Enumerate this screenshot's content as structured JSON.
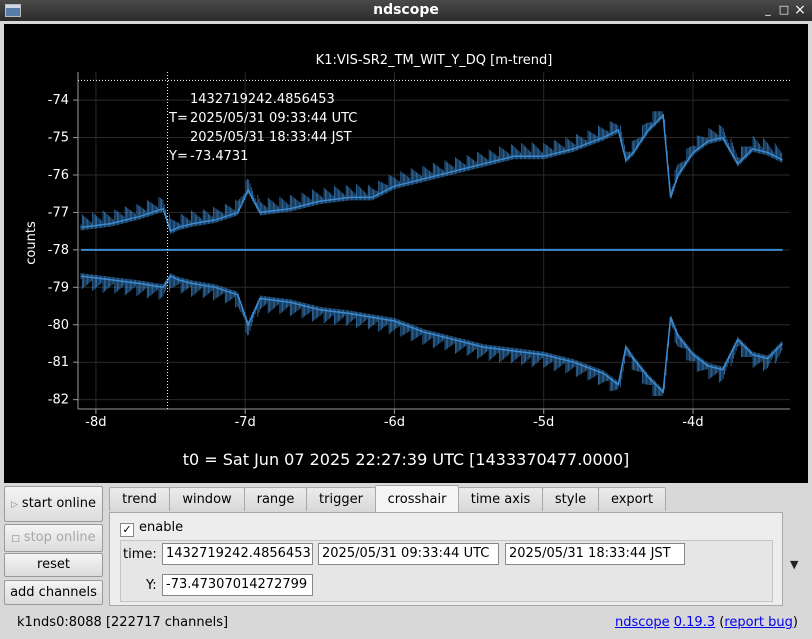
{
  "window": {
    "title": "ndscope",
    "minimize": "_",
    "maximize": "□",
    "close": "×"
  },
  "plot": {
    "title": "K1:VIS-SR2_TM_WIT_Y_DQ [m-trend]",
    "ylabel": "counts",
    "t0_label": "t0 = Sat Jun 07 2025 22:27:39 UTC [1433370477.0000]",
    "crosshair": {
      "gps": "1432719242.4856453",
      "t_prefix": "T=",
      "utc": "2025/05/31 09:33:44 UTC",
      "jst": "2025/05/31 18:33:44 JST",
      "y_prefix": "Y=",
      "y": "-73.4731"
    },
    "trace_color": "#3c8ad0"
  },
  "chart_data": {
    "type": "line",
    "title": "K1:VIS-SR2_TM_WIT_Y_DQ [m-trend]",
    "ylabel": "counts",
    "xlabel": "",
    "x_unit": "days",
    "xlim": [
      -8.12,
      -3.35
    ],
    "ylim": [
      -82.25,
      -73.25
    ],
    "x_ticks": [
      -8,
      -7,
      -6,
      -5,
      -4
    ],
    "x_tick_labels": [
      "-8d",
      "-7d",
      "-6d",
      "-5d",
      "-4d"
    ],
    "y_ticks": [
      -74,
      -75,
      -76,
      -77,
      -78,
      -79,
      -80,
      -81,
      -82
    ],
    "y_tick_labels": [
      "-74",
      "-75",
      "-76",
      "-77",
      "-78",
      "-79",
      "-80",
      "-81",
      "-82"
    ],
    "grid": true,
    "crosshair": {
      "x": -7.52,
      "y": -73.4731
    },
    "series": [
      {
        "role": "max",
        "x": [
          -8.1,
          -7.9,
          -7.7,
          -7.55,
          -7.5,
          -7.45,
          -7.35,
          -7.2,
          -7.05,
          -6.98,
          -6.9,
          -6.7,
          -6.5,
          -6.3,
          -6.15,
          -6.0,
          -5.8,
          -5.6,
          -5.4,
          -5.2,
          -5.0,
          -4.8,
          -4.6,
          -4.5,
          -4.45,
          -4.4,
          -4.3,
          -4.2,
          -4.15,
          -4.1,
          -4.0,
          -3.9,
          -3.8,
          -3.7,
          -3.6,
          -3.5,
          -3.4
        ],
        "values": [
          -77.4,
          -77.3,
          -77.1,
          -76.9,
          -77.5,
          -77.4,
          -77.3,
          -77.2,
          -77.0,
          -76.4,
          -77.0,
          -76.9,
          -76.7,
          -76.6,
          -76.6,
          -76.3,
          -76.1,
          -75.9,
          -75.7,
          -75.5,
          -75.5,
          -75.3,
          -75.0,
          -74.8,
          -75.6,
          -75.4,
          -74.8,
          -74.4,
          -76.6,
          -76.0,
          -75.4,
          -75.1,
          -75.0,
          -75.7,
          -75.3,
          -75.4,
          -75.6
        ]
      },
      {
        "role": "mean",
        "x": [
          -8.1,
          -3.4
        ],
        "values": [
          -78.0,
          -78.0
        ]
      },
      {
        "role": "min",
        "x": [
          -8.1,
          -7.9,
          -7.7,
          -7.55,
          -7.5,
          -7.45,
          -7.35,
          -7.2,
          -7.05,
          -6.98,
          -6.9,
          -6.7,
          -6.5,
          -6.3,
          -6.15,
          -6.0,
          -5.8,
          -5.6,
          -5.4,
          -5.2,
          -5.0,
          -4.8,
          -4.6,
          -4.5,
          -4.45,
          -4.4,
          -4.3,
          -4.2,
          -4.15,
          -4.1,
          -4.0,
          -3.9,
          -3.8,
          -3.7,
          -3.6,
          -3.5,
          -3.4
        ],
        "values": [
          -78.7,
          -78.8,
          -78.9,
          -79.0,
          -78.7,
          -78.8,
          -78.9,
          -79.0,
          -79.2,
          -80.0,
          -79.3,
          -79.4,
          -79.6,
          -79.7,
          -79.8,
          -79.9,
          -80.2,
          -80.4,
          -80.6,
          -80.7,
          -80.8,
          -81.0,
          -81.3,
          -81.6,
          -80.6,
          -80.9,
          -81.4,
          -81.8,
          -79.8,
          -80.3,
          -80.8,
          -81.1,
          -81.2,
          -80.4,
          -80.8,
          -80.9,
          -80.5
        ]
      }
    ]
  },
  "tabs": [
    {
      "label": "trend"
    },
    {
      "label": "window"
    },
    {
      "label": "range"
    },
    {
      "label": "trigger"
    },
    {
      "label": "crosshair",
      "active": true
    },
    {
      "label": "time axis"
    },
    {
      "label": "style"
    },
    {
      "label": "export"
    }
  ],
  "buttons": {
    "start_online": "start online",
    "stop_online": "stop online",
    "reset": "reset",
    "add_channels": "add channels"
  },
  "crosshair_panel": {
    "enable_label": "enable",
    "enable_checked": true,
    "check_glyph": "✓",
    "time_label": "time:",
    "time_gps": "1432719242.4856453",
    "time_utc": "2025/05/31 09:33:44 UTC",
    "time_jst": "2025/05/31 18:33:44 JST",
    "y_label": "Y:",
    "y_value": "-73.47307014272799"
  },
  "status": {
    "server": "k1nds0:8088",
    "channels": "[222717 channels]",
    "app_link": "ndscope",
    "version_link": "0.19.3",
    "paren_open": "(",
    "report_link": "report bug",
    "paren_close": ")"
  }
}
